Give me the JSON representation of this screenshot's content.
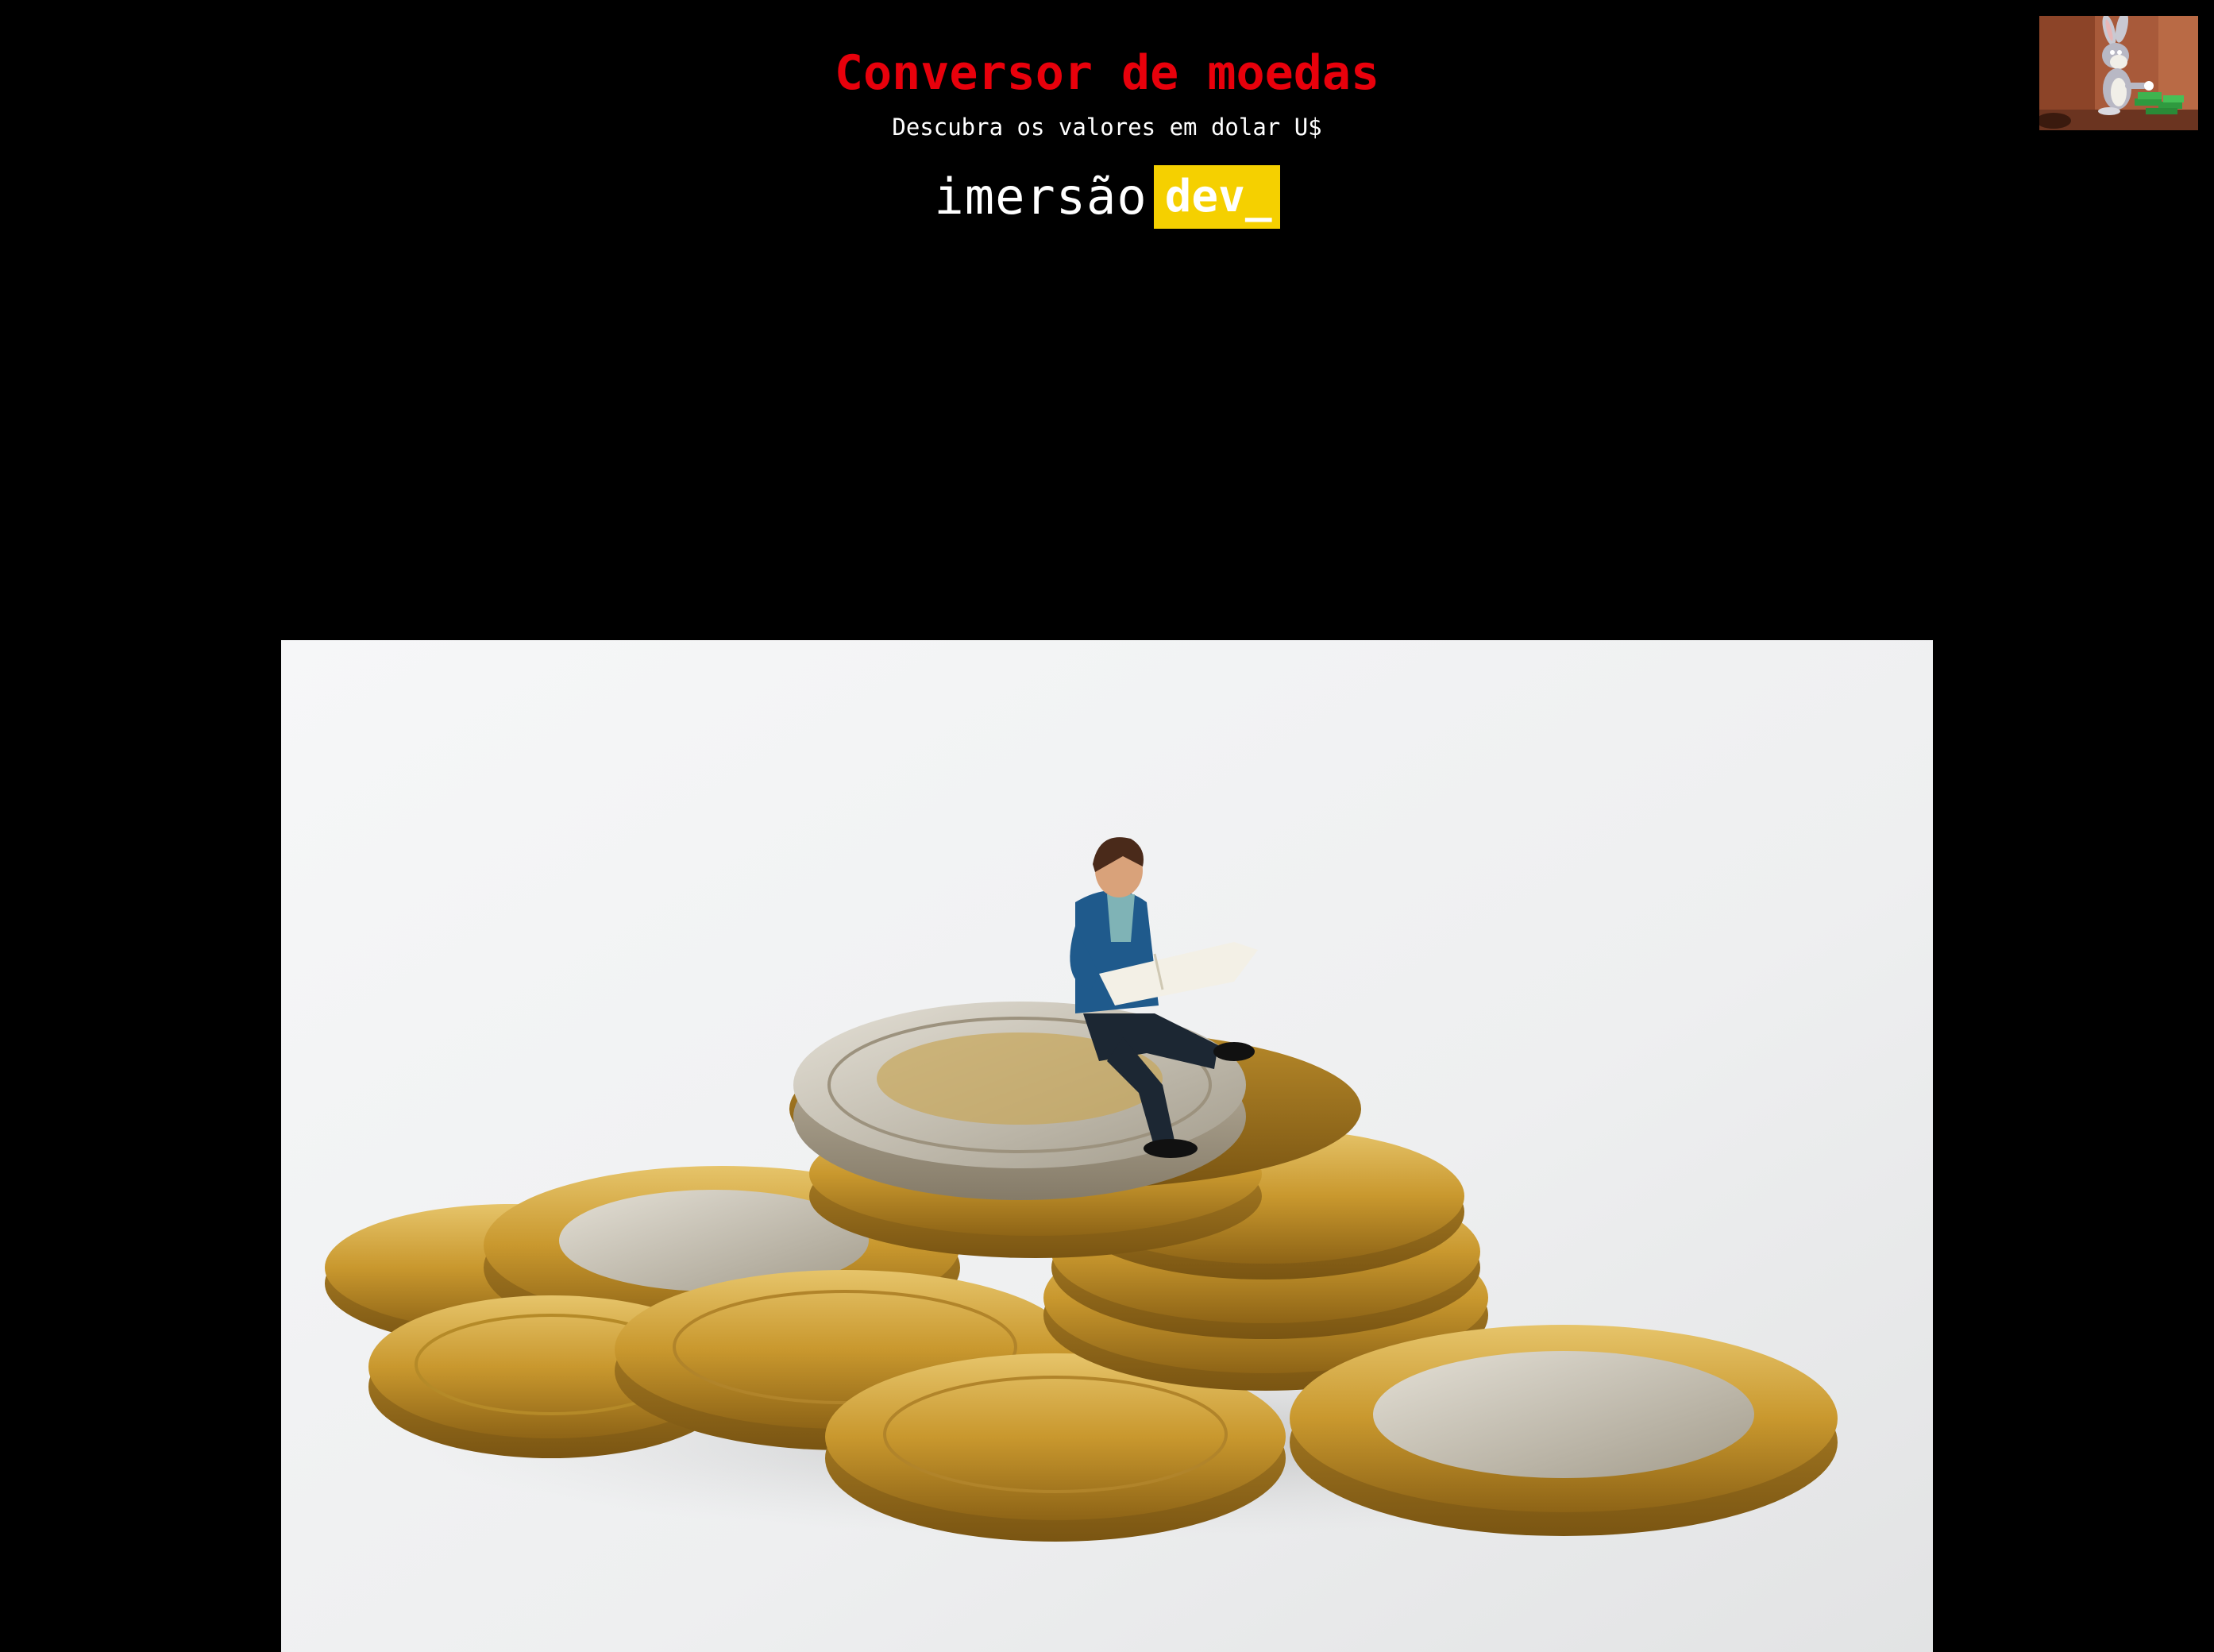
{
  "header": {
    "title": "Conversor de moedas",
    "subtitle": "Descubra os valores em dolar U$",
    "brand_word": "imersão",
    "brand_tag": "dev_"
  },
  "colors": {
    "background": "#000000",
    "title": "#e8000b",
    "brand_tag_bg": "#f5d000",
    "text": "#ffffff"
  },
  "icons": {
    "avatar": "bugs-bunny-counting-money-icon"
  }
}
